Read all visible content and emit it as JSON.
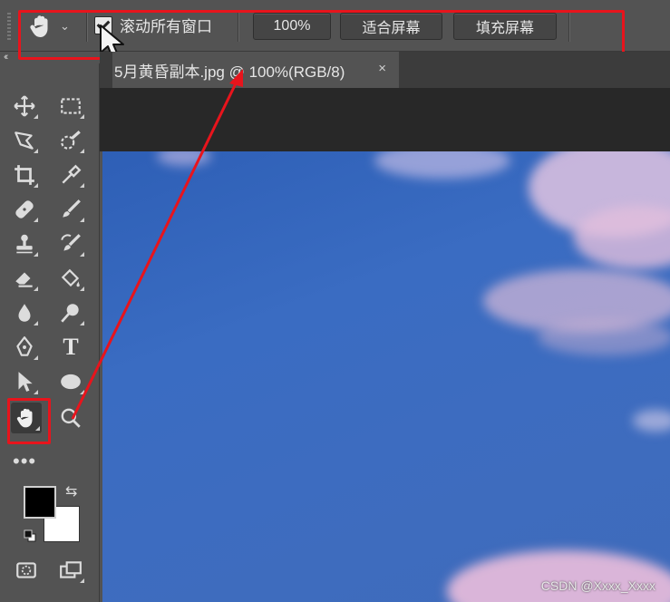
{
  "options_bar": {
    "checkbox_label": "滚动所有窗口",
    "checkbox_checked": true,
    "zoom_button": "100%",
    "fit_screen_button": "适合屏幕",
    "fill_screen_button": "填充屏幕"
  },
  "document_tab": {
    "title": "5月黄昏副本.jpg @ 100%(RGB/8)",
    "close_glyph": "×"
  },
  "toolbar": {
    "collapse_glyph": "‹‹",
    "more_glyph": "•••",
    "type_tool_glyph": "T",
    "swap_glyph": "⇆"
  },
  "colors": {
    "foreground": "#000000",
    "background": "#ffffff",
    "annotation_red": "#e8141c",
    "ui_panel": "#535353"
  },
  "watermark": "CSDN @Xxxx_Xxxx"
}
